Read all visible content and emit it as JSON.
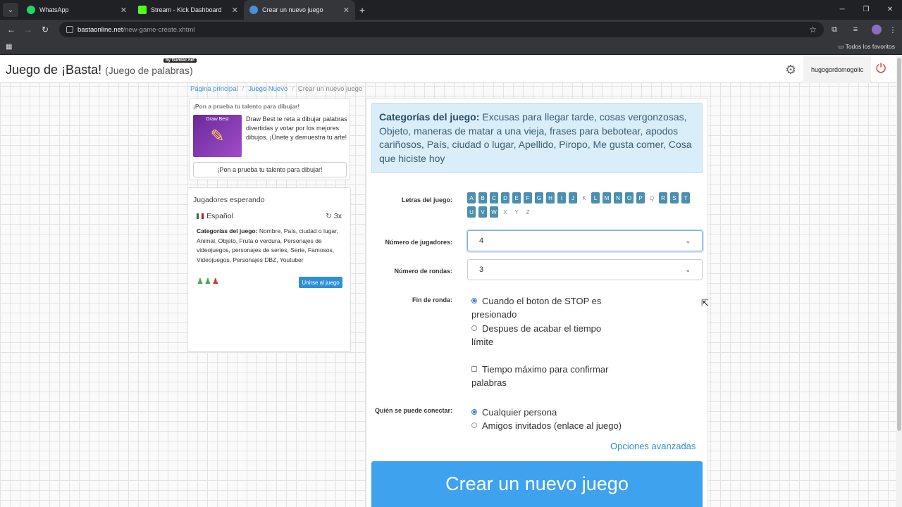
{
  "browser": {
    "tabs": [
      {
        "title": "WhatsApp",
        "active": false,
        "favicon_color": "#25d366"
      },
      {
        "title": "Stream - Kick Dashboard",
        "active": false,
        "favicon_color": "#53fc18"
      },
      {
        "title": "Crear un nuevo juego",
        "active": true,
        "favicon_color": "#4a90d9"
      }
    ],
    "url_host": "bastaonline.net",
    "url_path": "/new-game-create.xhtml",
    "bookmarks_label": "Todos los favoritos"
  },
  "header": {
    "brand": "Juego de ¡Basta!",
    "brand_sub": "(Juego de palabras)",
    "badge": "by Gamiac.net",
    "username": "hugogordomogolic"
  },
  "breadcrumb": {
    "home": "Página principal",
    "new_game": "Juego Nuevo",
    "current": "Crear un nuevo juego"
  },
  "ad": {
    "title": "¡Pon a prueba tu talento para dibujar!",
    "image_caption": "Draw Best",
    "text": "Draw Best te reta a dibujar palabras divertidas y votar por los mejores dibujos. ¡Únete y demuestra tu arte!",
    "button": "¡Pon a prueba tu talento para dibujar!"
  },
  "waiting": {
    "title": "Jugadores esperando",
    "language": "Español",
    "rounds": "3x",
    "categories_label": "Categorías del juego:",
    "categories": "Nombre, País, ciudad o lugar, Animal, Objeto, Fruta o verdura, Personajes de videojuegos, personajes de series, Serie, Famosos, Videojuegos, Personajes DBZ, Youtuber",
    "players": [
      "green",
      "green",
      "red"
    ],
    "join_button": "Unirse al juego"
  },
  "form": {
    "categories_label": "Categorías del juego:",
    "categories": "Excusas para llegar tarde, cosas vergonzosas, Objeto, maneras de matar a una vieja, frases para bebotear, apodos cariñosos, País, ciudad o lugar, Apellido, Piropo, Me gusta comer, Cosa que hiciste hoy",
    "letters_label": "Letras del juego:",
    "letters": [
      {
        "l": "A",
        "on": true
      },
      {
        "l": "B",
        "on": true
      },
      {
        "l": "C",
        "on": true
      },
      {
        "l": "D",
        "on": true
      },
      {
        "l": "E",
        "on": true
      },
      {
        "l": "F",
        "on": true
      },
      {
        "l": "G",
        "on": true
      },
      {
        "l": "H",
        "on": true
      },
      {
        "l": "I",
        "on": true
      },
      {
        "l": "J",
        "on": true
      },
      {
        "l": "K",
        "on": false
      },
      {
        "l": "L",
        "on": true
      },
      {
        "l": "M",
        "on": true
      },
      {
        "l": "N",
        "on": true
      },
      {
        "l": "O",
        "on": true
      },
      {
        "l": "P",
        "on": true
      },
      {
        "l": "Q",
        "on": false
      },
      {
        "l": "R",
        "on": true
      },
      {
        "l": "S",
        "on": true
      },
      {
        "l": "T",
        "on": true
      },
      {
        "l": "U",
        "on": true
      },
      {
        "l": "V",
        "on": true
      },
      {
        "l": "W",
        "on": true
      },
      {
        "l": "X",
        "on": false
      },
      {
        "l": "Y",
        "on": false
      },
      {
        "l": "Z",
        "on": false
      }
    ],
    "players_label": "Número de jugadores:",
    "players_value": "4",
    "rounds_label": "Número de rondas:",
    "rounds_value": "3",
    "end_label": "Fin de ronda:",
    "end_option_1": "Cuando el boton de STOP es presionado",
    "end_option_2": "Despues de acabar el tiempo límite",
    "confirm_option": "Tiempo máximo para confirmar palabras",
    "connect_label": "Quién se puede conectar:",
    "connect_option_1": "Cualquier persona",
    "connect_option_2": "Amigos invitados (enlace al juego)",
    "advanced": "Opciones avanzadas",
    "create_button": "Crear un nuevo juego"
  }
}
